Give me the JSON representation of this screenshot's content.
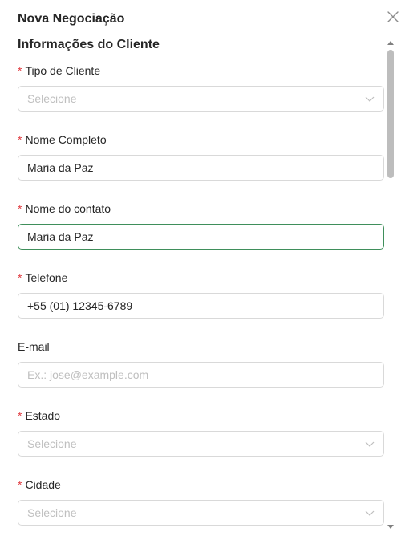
{
  "modal": {
    "title": "Nova Negociação",
    "section_title": "Informações do Cliente"
  },
  "form": {
    "tipo_cliente": {
      "label": "Tipo de Cliente",
      "required": "*",
      "placeholder": "Selecione"
    },
    "nome_completo": {
      "label": "Nome Completo",
      "required": "*",
      "value": "Maria da Paz"
    },
    "nome_contato": {
      "label": "Nome do contato",
      "required": "*",
      "value": "Maria da Paz"
    },
    "telefone": {
      "label": "Telefone",
      "required": "*",
      "value": "+55 (01) 12345-6789"
    },
    "email": {
      "label": "E-mail",
      "placeholder": "Ex.: jose@example.com"
    },
    "estado": {
      "label": "Estado",
      "required": "*",
      "placeholder": "Selecione"
    },
    "cidade": {
      "label": "Cidade",
      "required": "*",
      "placeholder": "Selecione"
    }
  },
  "icons": {
    "close": "close-icon",
    "dropdown": "chevron-down-icon",
    "scroll_up": "scroll-up-arrow-icon",
    "scroll_down": "scroll-down-arrow-icon"
  },
  "colors": {
    "required": "#e0393e",
    "focus_border": "#3f8f5b",
    "placeholder": "#bfbfbf",
    "border": "#d9d9d9"
  }
}
